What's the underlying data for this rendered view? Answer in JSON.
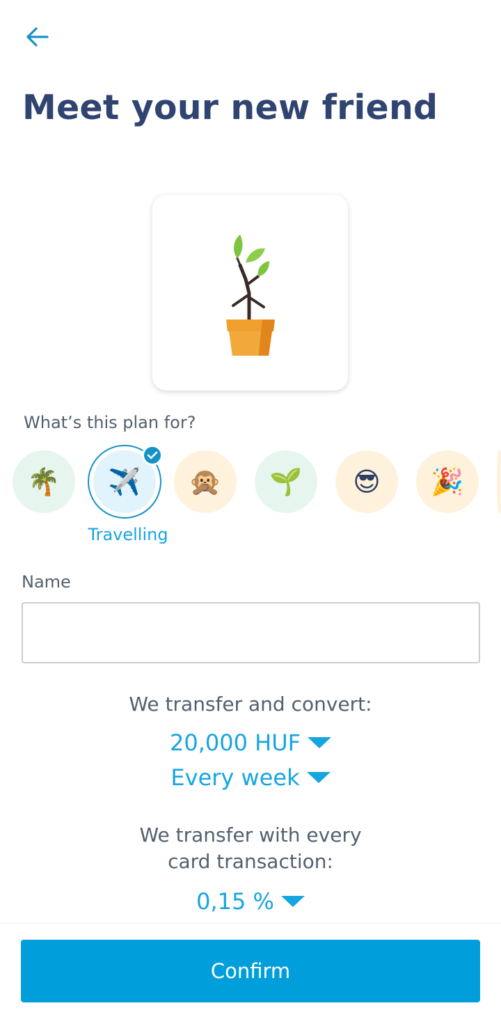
{
  "header": {
    "back_icon": "arrow-left-icon",
    "title": "Meet your new friend"
  },
  "plan_image": {
    "icon": "potted-plant-icon"
  },
  "categories": {
    "question": "What’s this plan for?",
    "items": [
      {
        "emoji": "🌴",
        "name": "palm-tree"
      },
      {
        "emoji": "✈️",
        "name": "airplane",
        "label": "Travelling",
        "selected": true
      },
      {
        "emoji": "🙊",
        "name": "monkey"
      },
      {
        "emoji": "🌱",
        "name": "seedling"
      },
      {
        "emoji": "😎",
        "name": "sunglasses-face"
      },
      {
        "emoji": "🎉",
        "name": "party-popper"
      }
    ]
  },
  "name_field": {
    "label": "Name",
    "value": "",
    "placeholder": ""
  },
  "transfer": {
    "heading": "We transfer and convert:",
    "amount": "20,000 HUF",
    "frequency": "Every week"
  },
  "card_transfer": {
    "heading_line1": "We transfer with every",
    "heading_line2": "card transaction:",
    "percent": "0,15 %"
  },
  "footer": {
    "confirm_label": "Confirm"
  },
  "colors": {
    "accent": "#16a5e0",
    "button": "#009fdb",
    "title": "#2f4470"
  }
}
